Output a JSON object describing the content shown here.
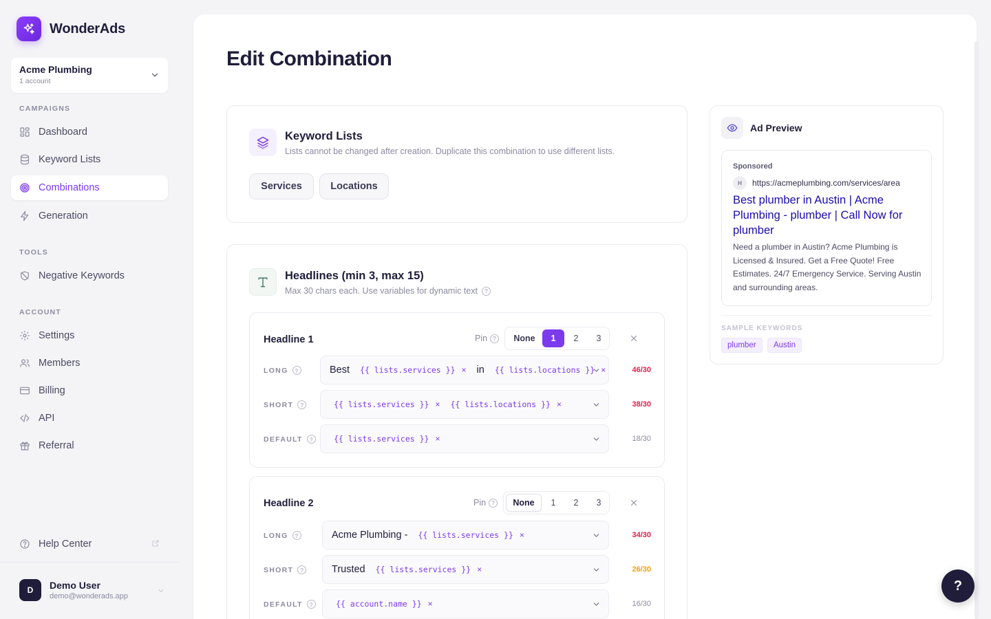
{
  "brand": {
    "name": "WonderAds"
  },
  "account": {
    "name": "Acme Plumbing",
    "sub": "1 account"
  },
  "nav": {
    "campaigns_title": "CAMPAIGNS",
    "campaigns": [
      {
        "label": "Dashboard",
        "icon": "dashboard-icon"
      },
      {
        "label": "Keyword Lists",
        "icon": "database-icon"
      },
      {
        "label": "Combinations",
        "icon": "target-icon",
        "active": true
      },
      {
        "label": "Generation",
        "icon": "bolt-icon"
      }
    ],
    "tools_title": "TOOLS",
    "tools": [
      {
        "label": "Negative Keywords",
        "icon": "shield-off-icon"
      }
    ],
    "account_title": "ACCOUNT",
    "account": [
      {
        "label": "Settings",
        "icon": "gear-icon"
      },
      {
        "label": "Members",
        "icon": "users-icon"
      },
      {
        "label": "Billing",
        "icon": "card-icon"
      },
      {
        "label": "API",
        "icon": "code-icon"
      },
      {
        "label": "Referral",
        "icon": "gift-icon"
      }
    ],
    "help": "Help Center"
  },
  "user": {
    "initial": "D",
    "name": "Demo User",
    "email": "demo@wonderads.app"
  },
  "page": {
    "title": "Edit Combination"
  },
  "keyword_lists": {
    "title": "Keyword Lists",
    "subtitle": "Lists cannot be changed after creation. Duplicate this combination to use different lists.",
    "lists": [
      "Services",
      "Locations"
    ]
  },
  "headlines": {
    "title": "Headlines (min 3, max 15)",
    "subtitle": "Max 30 chars each. Use variables for dynamic text",
    "pin_label": "Pin",
    "pin_options": [
      "None",
      "1",
      "2",
      "3"
    ],
    "field_labels": [
      "LONG",
      "SHORT",
      "DEFAULT"
    ],
    "items": [
      {
        "title": "Headline 1",
        "pin": "1",
        "long": {
          "text1": "Best",
          "var1": "{{ lists.services }}",
          "text2": "in",
          "var2": "{{ lists.locations }}",
          "count": "46/30",
          "status": "over"
        },
        "short": {
          "var1": "{{ lists.services }}",
          "var2": "{{ lists.locations }}",
          "count": "38/30",
          "status": "over"
        },
        "default": {
          "var1": "{{ lists.services }}",
          "count": "18/30",
          "status": "ok"
        }
      },
      {
        "title": "Headline 2",
        "pin": "None",
        "long": {
          "text1": "Acme Plumbing -",
          "var1": "{{ lists.services }}",
          "count": "34/30",
          "status": "over"
        },
        "short": {
          "text1": "Trusted",
          "var1": "{{ lists.services }}",
          "count": "26/30",
          "status": "warn"
        },
        "default": {
          "var1": "{{ account.name }}",
          "count": "16/30",
          "status": "ok"
        }
      }
    ]
  },
  "preview": {
    "title": "Ad Preview",
    "sponsored": "Sponsored",
    "favicon": "H",
    "url": "https://acmeplumbing.com/services/area",
    "headline": "Best plumber in Austin | Acme Plumbing - plumber | Call Now for plumber",
    "description": "Need a plumber in Austin? Acme Plumbing is Licensed & Insured. Get a Free Quote! Free Estimates. 24/7 Emergency Service. Serving Austin and surrounding areas.",
    "sample_title": "SAMPLE KEYWORDS",
    "sample_keywords": [
      "plumber",
      "Austin"
    ]
  },
  "fab": {
    "label": "?"
  },
  "colors": {
    "accent": "#7c3aed",
    "over": "#e11d48",
    "warn": "#f59e0b",
    "dark": "#1f1d3a",
    "link": "#1a0dab"
  }
}
